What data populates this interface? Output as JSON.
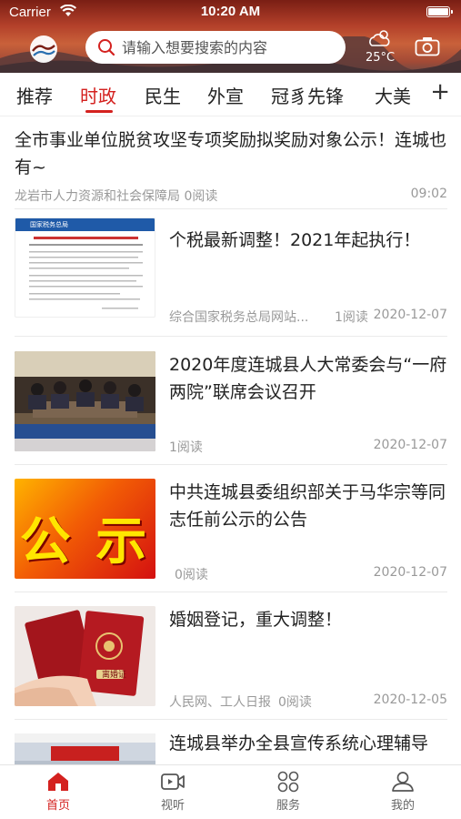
{
  "status_bar": {
    "carrier": "Carrier",
    "time": "10:20 AM"
  },
  "header": {
    "search_placeholder": "请输入想要搜索的内容",
    "weather_temp": "25°C"
  },
  "tabs": [
    {
      "label": "推荐",
      "active": false
    },
    {
      "label": "时政",
      "active": true
    },
    {
      "label": "民生",
      "active": false
    },
    {
      "label": "外宣",
      "active": false
    },
    {
      "label": "冠豸先锋",
      "active": false
    },
    {
      "label": "大美",
      "active": false
    }
  ],
  "tab_add": "+",
  "feed": [
    {
      "title": "全市事业单位脱贫攻坚专项奖励拟奖励对象公示！连城也有~",
      "source": "龙岩市人力资源和社会保障局 0阅读",
      "time": "09:02"
    },
    {
      "title": "个税最新调整！2021年起执行！",
      "source": "综合国家税务总局网站...",
      "reads": "1阅读",
      "date": "2020-12-07",
      "thumb_header": "国家税务总局"
    },
    {
      "title": "2020年度连城县人大常委会与“一府两院”联席会议召开",
      "source": "",
      "reads": "1阅读",
      "date": "2020-12-07"
    },
    {
      "title": "中共连城县委组织部关于马华宗等同志任前公示的公告",
      "source": "",
      "reads": "0阅读",
      "date": "2020-12-07",
      "thumb_text": "公 示"
    },
    {
      "title": "婚姻登记，重大调整！",
      "source": "人民网、工人日报",
      "reads": "0阅读",
      "date": "2020-12-05",
      "thumb_cert": "离婚证"
    },
    {
      "title": "连城县举办全县宣传系统心理辅导"
    }
  ],
  "bottom_nav": [
    {
      "label": "首页",
      "icon": "home-icon",
      "active": true
    },
    {
      "label": "视听",
      "icon": "video-icon",
      "active": false
    },
    {
      "label": "服务",
      "icon": "services-icon",
      "active": false
    },
    {
      "label": "我的",
      "icon": "profile-icon",
      "active": false
    }
  ],
  "colors": {
    "accent": "#d4211f",
    "muted": "#999999"
  }
}
